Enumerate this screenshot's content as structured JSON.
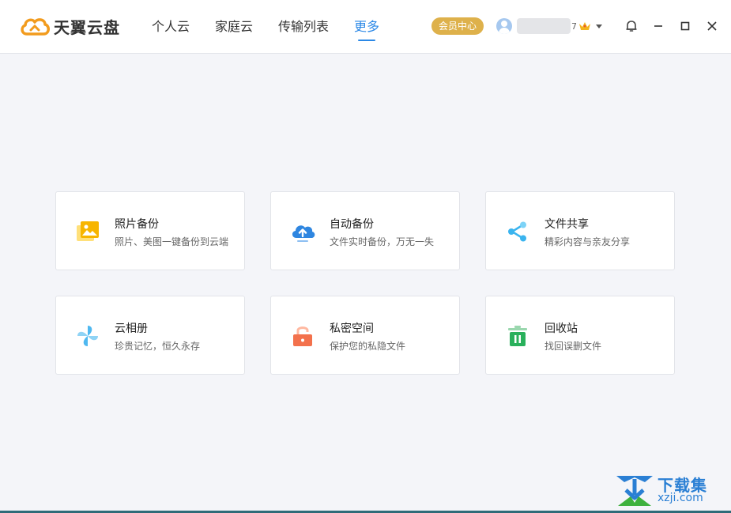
{
  "app": {
    "name": "天翼云盘"
  },
  "nav": {
    "tabs": [
      {
        "label": "个人云"
      },
      {
        "label": "家庭云"
      },
      {
        "label": "传输列表"
      },
      {
        "label": "更多",
        "active": true
      }
    ]
  },
  "header": {
    "vip_label": "会员中心",
    "username_suffix": "7"
  },
  "colors": {
    "accent": "#2b88e6",
    "vip_gold": "#deb14b",
    "background": "#f4f5f9"
  },
  "features": [
    {
      "title": "照片备份",
      "desc": "照片、美图一键备份到云端",
      "icon": "photo-backup-icon"
    },
    {
      "title": "自动备份",
      "desc": "文件实时备份，万无一失",
      "icon": "cloud-upload-icon"
    },
    {
      "title": "文件共享",
      "desc": "精彩内容与亲友分享",
      "icon": "share-icon"
    },
    {
      "title": "云相册",
      "desc": "珍贵记忆，恒久永存",
      "icon": "pinwheel-album-icon"
    },
    {
      "title": "私密空间",
      "desc": "保护您的私隐文件",
      "icon": "lock-icon"
    },
    {
      "title": "回收站",
      "desc": "找回误删文件",
      "icon": "trash-icon"
    }
  ],
  "watermark": {
    "cn": "下载集",
    "en": "xzji.com"
  }
}
